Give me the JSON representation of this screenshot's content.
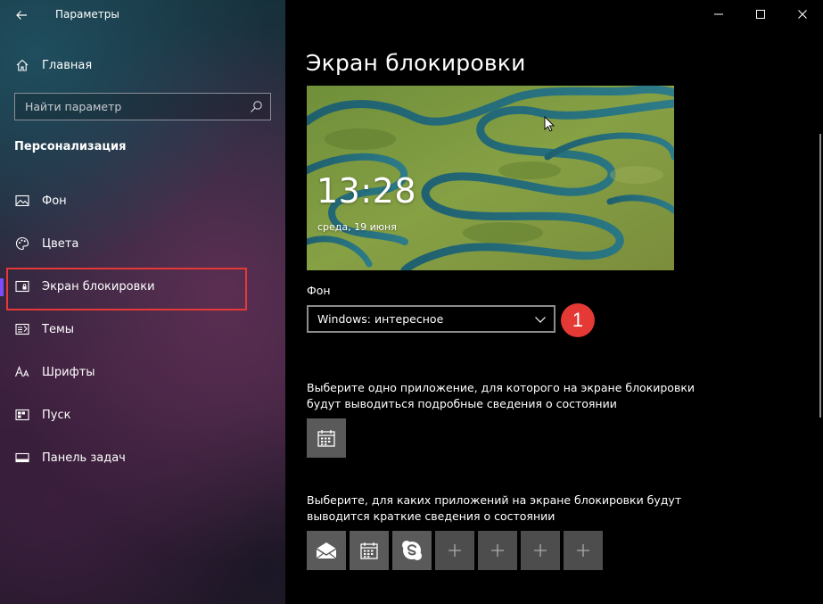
{
  "window": {
    "title": "Параметры"
  },
  "sidebar": {
    "home_label": "Главная",
    "search_placeholder": "Найти параметр",
    "section_title": "Персонализация",
    "items": [
      {
        "label": "Фон",
        "icon": "picture-icon"
      },
      {
        "label": "Цвета",
        "icon": "palette-icon"
      },
      {
        "label": "Экран блокировки",
        "icon": "lock-screen-icon",
        "selected": true
      },
      {
        "label": "Темы",
        "icon": "themes-icon"
      },
      {
        "label": "Шрифты",
        "icon": "fonts-icon"
      },
      {
        "label": "Пуск",
        "icon": "start-icon"
      },
      {
        "label": "Панель задач",
        "icon": "taskbar-icon"
      }
    ]
  },
  "main": {
    "page_title": "Экран блокировки",
    "preview": {
      "time": "13:28",
      "date": "среда, 19 июня"
    },
    "background": {
      "label": "Фон",
      "selected_value": "Windows: интересное"
    },
    "step_badge": "1",
    "detailed_status": {
      "description": "Выберите одно приложение, для которого на экране блокировки будут выводиться подробные сведения о состоянии",
      "apps": [
        "calendar-icon"
      ]
    },
    "quick_status": {
      "description": "Выберите, для каких приложений на экране блокировки будут выводится краткие сведения о состоянии",
      "apps": [
        "mail-icon",
        "calendar-icon",
        "skype-icon",
        "+",
        "+",
        "+",
        "+"
      ]
    }
  },
  "colors": {
    "accent": "#7c4dff",
    "highlight": "#e53935",
    "tile": "#5a5a5a"
  }
}
